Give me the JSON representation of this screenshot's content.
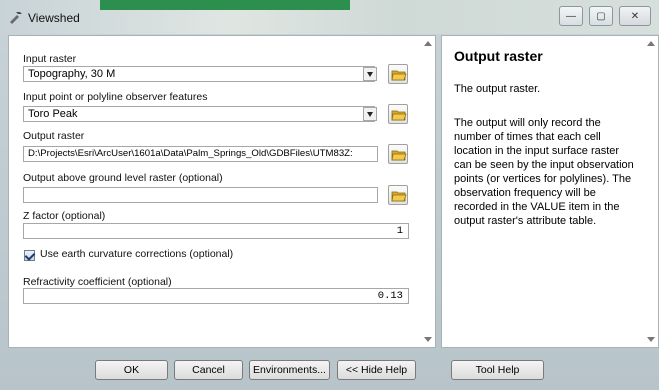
{
  "window": {
    "title": "Viewshed",
    "controls": [
      "minimize",
      "restore",
      "close"
    ]
  },
  "form": {
    "input_raster_label": "Input raster",
    "input_raster_value": "Topography, 30 M",
    "observer_label": "Input point or polyline observer features",
    "observer_value": "Toro Peak",
    "output_raster_label": "Output raster",
    "output_raster_value": "D:\\Projects\\Esri\\ArcUser\\1601a\\Data\\Palm_Springs_Old\\GDBFiles\\UTM83Z:",
    "above_ground_label": "Output above ground level raster (optional)",
    "above_ground_value": "",
    "z_factor_label": "Z factor (optional)",
    "z_factor_value": "1",
    "curvature_label": "Use earth curvature corrections (optional)",
    "curvature_checked": true,
    "refractivity_label": "Refractivity coefficient (optional)",
    "refractivity_value": "0.13"
  },
  "help": {
    "title": "Output raster",
    "p1": "The output raster.",
    "p2": "The output will only record the number of times that each cell location in the input surface raster can be seen by the input observation points (or vertices for polylines). The observation frequency will be recorded in the VALUE item in the output raster's attribute table."
  },
  "buttons": {
    "ok": "OK",
    "cancel": "Cancel",
    "environments": "Environments...",
    "hide_help": "<< Hide Help",
    "tool_help": "Tool Help"
  },
  "icons": {
    "title": "hammer-icon",
    "browse": "open-folder-icon",
    "check": "check-icon"
  }
}
